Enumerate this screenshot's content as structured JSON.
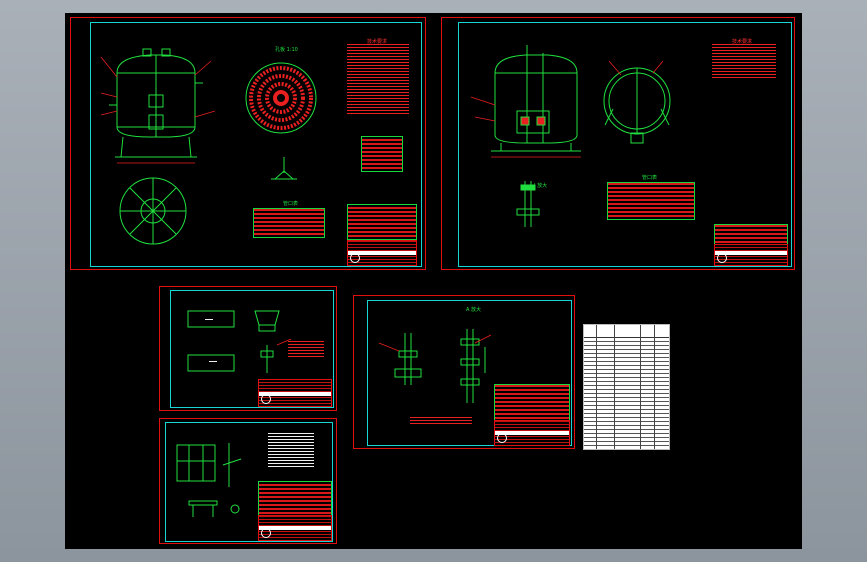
{
  "window": {
    "title": "",
    "background": "#8c949d"
  },
  "colors": {
    "canvas": "#000000",
    "sheet_border": "#e01010",
    "frame": "#19d6d6",
    "geometry": "#20e040",
    "annotation": "#e82020",
    "text": "#f0f0f0"
  },
  "sheets": [
    {
      "id": "sheet-1",
      "content": "tank elevation, top view, perforated plate, title block"
    },
    {
      "id": "sheet-2",
      "content": "tank elevation, plan view, detail, parts list, title block"
    },
    {
      "id": "sheet-3",
      "content": "bracket details, title block"
    },
    {
      "id": "sheet-4",
      "content": "pipe assembly detail, title block"
    },
    {
      "id": "sheet-5",
      "content": "frame detail, notes, title block"
    },
    {
      "id": "sheet-6",
      "content": "bill of materials"
    }
  ],
  "labels": {
    "s1_plate_title": "孔板 1:10",
    "s1_nozzle_title": "管口表",
    "s1_spec_title": "技术要求",
    "s2_spec_title": "技术要求",
    "s2_detail_title": "I 放大",
    "s2_table_title": "管口表",
    "s4_detail_title": "A 放大"
  }
}
